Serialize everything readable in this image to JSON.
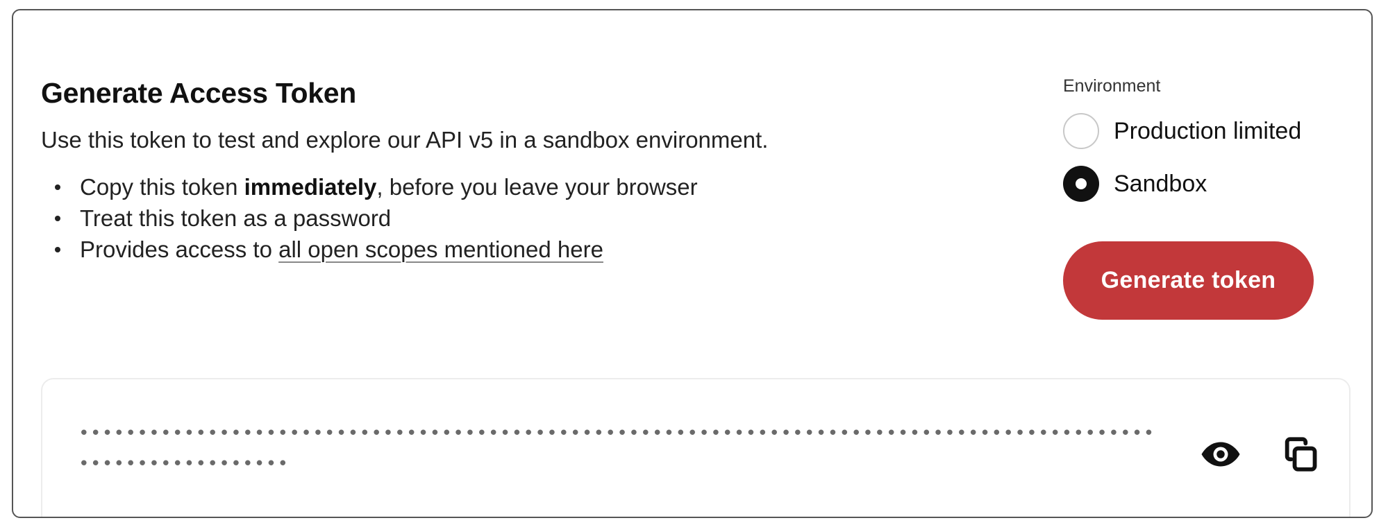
{
  "card": {
    "title": "Generate Access Token",
    "description": "Use this token to test and explore our API v5 in a sandbox environment."
  },
  "bullets": {
    "b1_pre": "Copy this token ",
    "b1_bold": "immediately",
    "b1_post": ", before you leave your browser",
    "b2": "Treat this token as a password",
    "b3_pre": "Provides access to ",
    "b3_link": "all open scopes mentioned here"
  },
  "environment": {
    "label": "Environment",
    "options": [
      {
        "label": "Production limited",
        "checked": false
      },
      {
        "label": "Sandbox",
        "checked": true
      }
    ],
    "selected": "Sandbox"
  },
  "generate_button": {
    "label": "Generate token",
    "color": "#c2383a"
  },
  "token": {
    "masked_value": "••••••••••••••••••••••••••••••••••••••••••••••••••••••••••••••••••••••••••••••••••••••••••••••••••••••••••••••",
    "visibility_icon": "eye-icon",
    "copy_icon": "copy-icon"
  }
}
